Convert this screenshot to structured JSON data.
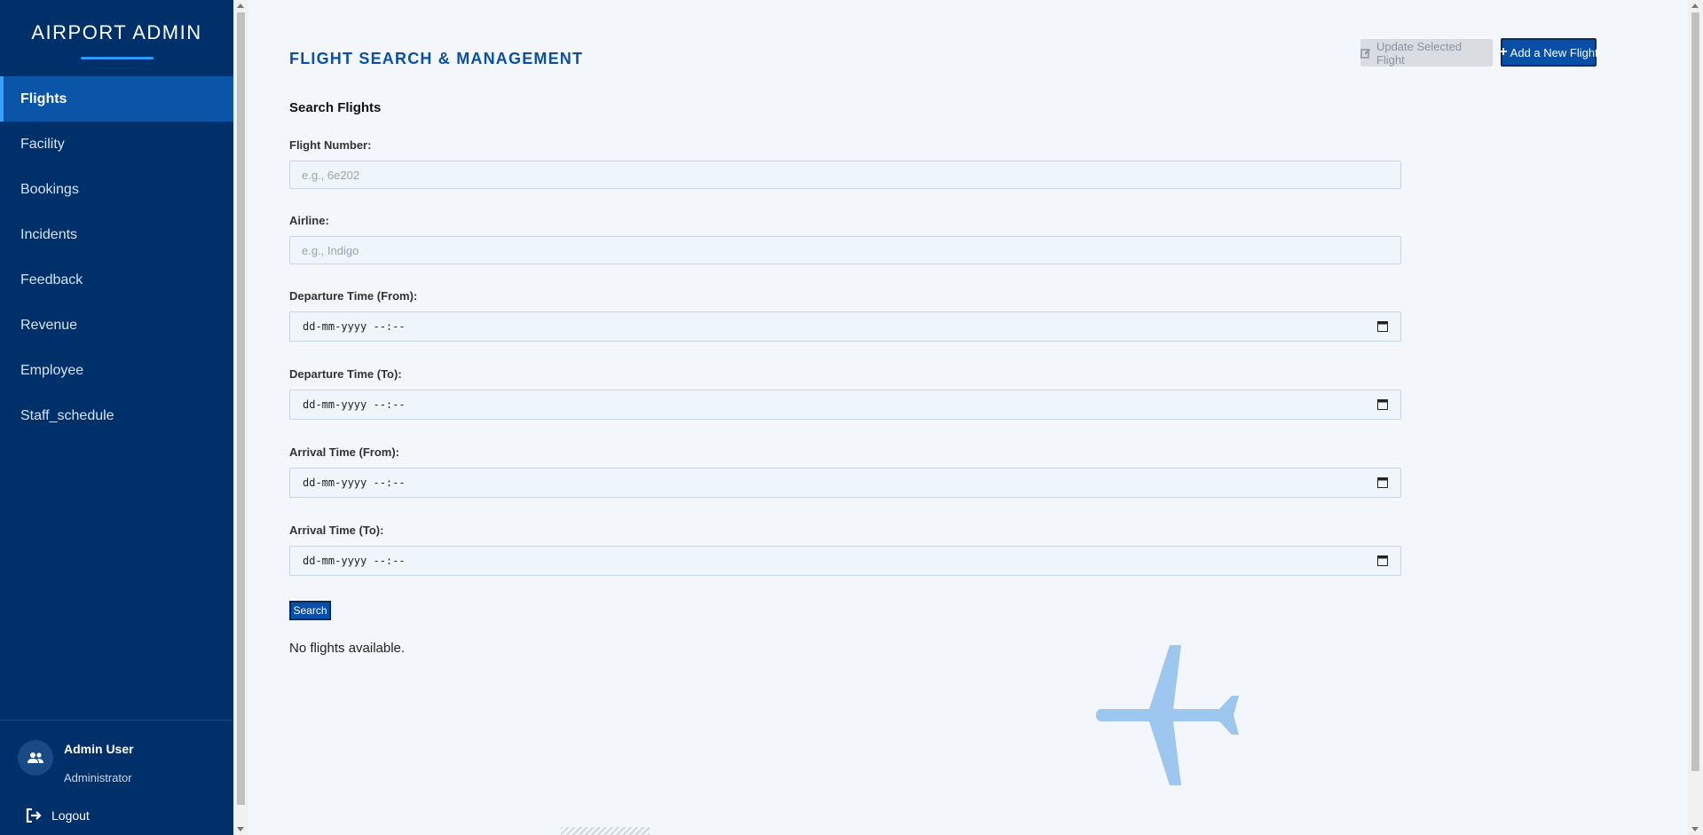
{
  "app": {
    "brand": "AIRPORT ADMIN"
  },
  "sidebar": {
    "items": [
      {
        "label": "Flights",
        "active": true
      },
      {
        "label": "Facility"
      },
      {
        "label": "Bookings"
      },
      {
        "label": "Incidents"
      },
      {
        "label": "Feedback"
      },
      {
        "label": "Revenue"
      },
      {
        "label": "Employee"
      },
      {
        "label": "Staff_schedule"
      }
    ],
    "user": {
      "name": "Admin User",
      "role": "Administrator"
    },
    "logout_label": "Logout"
  },
  "header": {
    "title": "FLIGHT SEARCH & MANAGEMENT",
    "update_label": "Update Selected Flight",
    "add_label": "Add a New Flight"
  },
  "search": {
    "title": "Search Flights",
    "flight_number": {
      "label": "Flight Number:",
      "placeholder": "e.g., 6e202"
    },
    "airline": {
      "label": "Airline:",
      "placeholder": "e.g., Indigo"
    },
    "departure_from": {
      "label": "Departure Time (From):",
      "value": "dd-mm-yyyy --:--"
    },
    "departure_to": {
      "label": "Departure Time (To):",
      "value": "dd-mm-yyyy --:--"
    },
    "arrival_from": {
      "label": "Arrival Time (From):",
      "value": "dd-mm-yyyy --:--"
    },
    "arrival_to": {
      "label": "Arrival Time (To):",
      "value": "dd-mm-yyyy --:--"
    },
    "button_label": "Search"
  },
  "results": {
    "empty_message": "No flights available."
  },
  "colors": {
    "sidebar": "#00306a",
    "active": "#0a55a8",
    "accent": "#0b4fa3",
    "plane": "#9ec7f0"
  }
}
